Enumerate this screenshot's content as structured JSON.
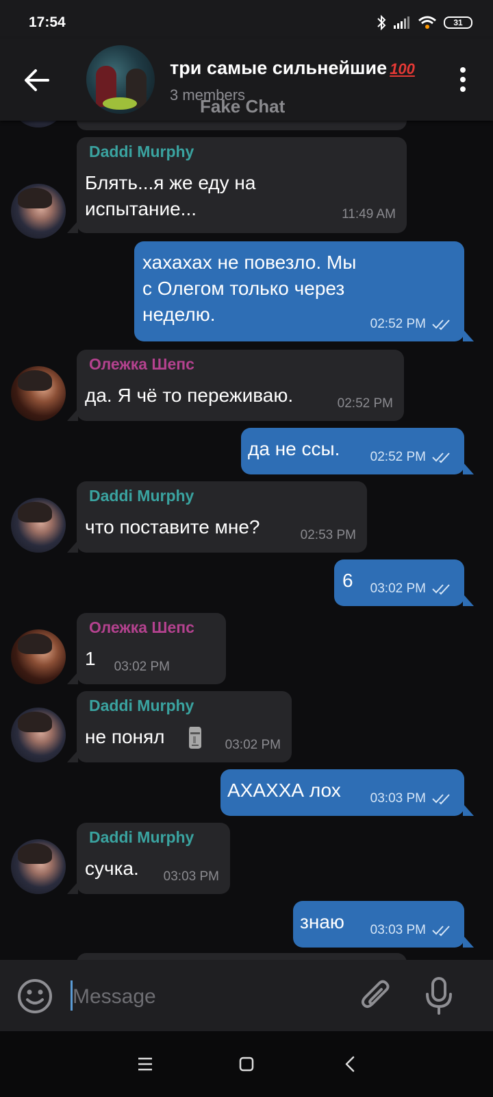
{
  "status_bar": {
    "time": "17:54",
    "battery": "31"
  },
  "header": {
    "title": "три самые сильнейшие",
    "title_emoji": "100",
    "subtitle": "3 members",
    "watermark": "Fake Chat"
  },
  "colors": {
    "outgoing_bubble": "#2e6eb5",
    "incoming_bubble": "#262629",
    "sender_teal": "#3aa3a0",
    "sender_pink": "#b4428f",
    "background": "#0d0d0f"
  },
  "messages": [
    {
      "sender": "Daddi Murphy",
      "text": "Блять...я же еду на\nиспытание...",
      "time": "11:49 AM"
    },
    {
      "text": "хахахах не повезло. Мы\nс Олегом только через\nнеделю.",
      "time": "02:52 PM"
    },
    {
      "sender": "Олежка Шепс",
      "text": "да. Я чё то переживаю.",
      "time": "02:52 PM"
    },
    {
      "text": "да не ссы.",
      "time": "02:52 PM"
    },
    {
      "sender": "Daddi Murphy",
      "text": "что поставите мне?",
      "time": "02:53 PM"
    },
    {
      "text": "6",
      "time": "03:02 PM"
    },
    {
      "sender": "Олежка Шепс",
      "text": "1",
      "time": "03:02 PM"
    },
    {
      "sender": "Daddi Murphy",
      "text": "не понял",
      "time": "03:02 PM"
    },
    {
      "text": "АХАХХА лох",
      "time": "03:03 PM"
    },
    {
      "sender": "Daddi Murphy",
      "text": "сучка.",
      "time": "03:03 PM"
    },
    {
      "text": "знаю",
      "time": "03:03 PM"
    }
  ],
  "composer": {
    "placeholder": "Message"
  },
  "icons": [
    "back-arrow-icon",
    "more-vert-icon",
    "emoji-icon",
    "attach-icon",
    "mic-icon",
    "moai-emoji-icon",
    "double-check-icon"
  ]
}
